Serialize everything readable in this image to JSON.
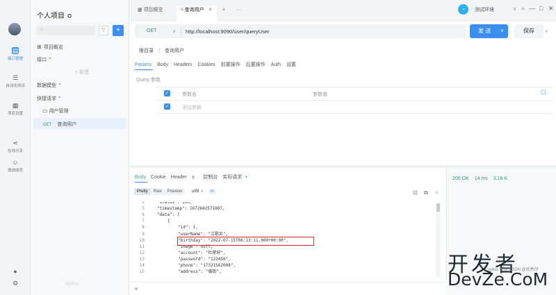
{
  "rail": {
    "items": [
      {
        "label": "接口管理",
        "icon": "api-icon"
      },
      {
        "label": "自动化测试",
        "icon": "test-icon"
      },
      {
        "label": "项目设置",
        "icon": "settings-icon"
      },
      {
        "label": "在线分享",
        "icon": "share-icon"
      },
      {
        "label": "邀请成员",
        "icon": "invite-icon"
      }
    ]
  },
  "sidebar": {
    "project_title": "个人项目 ≎",
    "overview": "项目概览",
    "interfaces": "接口 ⌃",
    "new_label": "+ 新建",
    "data_models": "数据模型 ⌃",
    "quick_requests": "快捷请求 ⌃",
    "folder": "用户管理",
    "request_method": "GET",
    "request_name": "查询用户",
    "footer": "Apifox"
  },
  "tabs": {
    "overview": "项目概览",
    "current": "查询用户",
    "add": "+",
    "more": "···",
    "env": "测试环境",
    "env_caret": "∨",
    "env_menu": "≡",
    "minimize": "—",
    "maximize": "□",
    "close": "✕"
  },
  "request": {
    "method": "GET",
    "method_caret": "∨",
    "url": "http://localhost:9090/user/queryUser",
    "send": "发 送",
    "send_caret": "∨",
    "save": "保存",
    "save_caret": "∨",
    "crumb_root": "根目录",
    "crumb_slash": "/",
    "crumb_current": "查询用户",
    "tabs": [
      "Params",
      "Body",
      "Headers",
      "Cookies",
      "前置操作",
      "后置操作",
      "Auth",
      "设置"
    ],
    "query_label": "Query 参数",
    "col_name": "参数名",
    "col_value": "参数值",
    "add_param_placeholder": "添加参数"
  },
  "response": {
    "tabs": {
      "body": "Body",
      "cookie": "Cookie",
      "header": "Header",
      "header_count": "8",
      "console": "控制台",
      "actual": "实际请求",
      "actual_dot": "•"
    },
    "formats": [
      "Pretty",
      "Raw",
      "Preview"
    ],
    "encoding": "utf8",
    "encoding_caret": "∨",
    "code": [
      {
        "ln": "4",
        "text": "\"status\": 100,",
        "indent": 2
      },
      {
        "ln": "5",
        "text": "\"timestamp\": 1672842571807,",
        "indent": 2
      },
      {
        "ln": "6",
        "text": "\"data\": [",
        "indent": 2
      },
      {
        "ln": "7",
        "text": "{",
        "indent": 4
      },
      {
        "ln": "8",
        "text": "\"id\": 1,",
        "indent": 6
      },
      {
        "ln": "9",
        "text": "\"userName\": \"江歌瓜\",",
        "indent": 6
      },
      {
        "ln": "10",
        "text": "\"birthday\": \"2022-07-15T06:13:11.000+00:00\",",
        "indent": 6
      },
      {
        "ln": "11",
        "text": "\"image\": null,",
        "indent": 6
      },
      {
        "ln": "12",
        "text": "\"account\": \"杜荣轩\",",
        "indent": 6
      },
      {
        "ln": "13",
        "text": "\"password\": \"123456\",",
        "indent": 6
      },
      {
        "ln": "14",
        "text": "\"phone\": \"17321562008\",",
        "indent": 6
      },
      {
        "ln": "15",
        "text": "\"address\": \"临街\",",
        "indent": 6
      }
    ],
    "collapse": "«"
  },
  "status": {
    "code": "200 OK",
    "time": "14 ms",
    "size": "3.16 K"
  },
  "watermark": {
    "cn": "开发者",
    "en": "DevZe.CoM",
    "small": "Cookie 管理  CSDN @优秀仔"
  },
  "colors": {
    "accent": "#3b8ff3",
    "ok": "#1b9e6a",
    "highlight": "#e02424"
  }
}
